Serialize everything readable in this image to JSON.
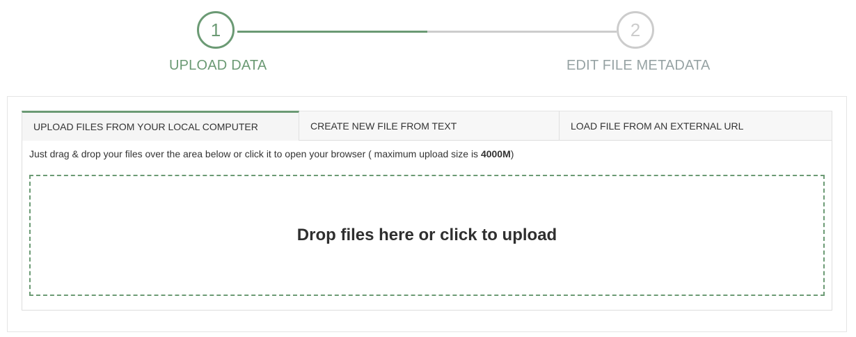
{
  "colors": {
    "accent": "#6b9a74",
    "inactive": "#cccccc",
    "inactive_text": "#97a3a4",
    "text": "#333333"
  },
  "stepper": {
    "steps": [
      {
        "number": "1",
        "label": "UPLOAD DATA",
        "state": "active"
      },
      {
        "number": "2",
        "label": "EDIT FILE METADATA",
        "state": "inactive"
      }
    ]
  },
  "tabs": [
    {
      "label": "UPLOAD FILES FROM YOUR LOCAL COMPUTER",
      "active": true
    },
    {
      "label": "CREATE NEW FILE FROM TEXT",
      "active": false
    },
    {
      "label": "LOAD FILE FROM AN EXTERNAL URL",
      "active": false
    }
  ],
  "upload": {
    "help_prefix": "Just drag & drop your files over the area below or click it to open your browser ( maximum upload size is ",
    "max_size": "4000M",
    "help_suffix": ")",
    "dropzone_text": "Drop files here or click to upload"
  }
}
